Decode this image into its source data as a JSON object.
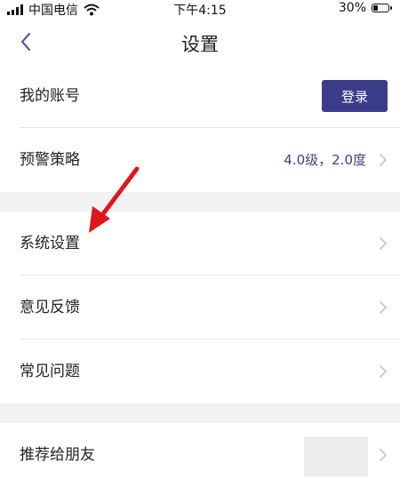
{
  "status_bar": {
    "carrier": "中国电信",
    "time": "下午4:15",
    "battery_percent": "30%",
    "battery_level": 0.3,
    "signal_icon": "signal-bars-icon",
    "wifi_icon": "wifi-icon"
  },
  "nav": {
    "title": "设置",
    "back_icon": "chevron-left-icon"
  },
  "account": {
    "label": "我的账号",
    "login_label": "登录"
  },
  "warning_policy": {
    "label": "预警策略",
    "value": "4.0级，2.0度"
  },
  "menu": {
    "system_settings": "系统设置",
    "feedback": "意见反馈",
    "faq": "常见问题",
    "recommend": "推荐给朋友"
  },
  "colors": {
    "accent": "#3b3c89",
    "value_text": "#3b3f8a",
    "section_gap": "#f2f2f4",
    "annotation_arrow": "#e0161c",
    "chevron": "#c7c7cc"
  }
}
